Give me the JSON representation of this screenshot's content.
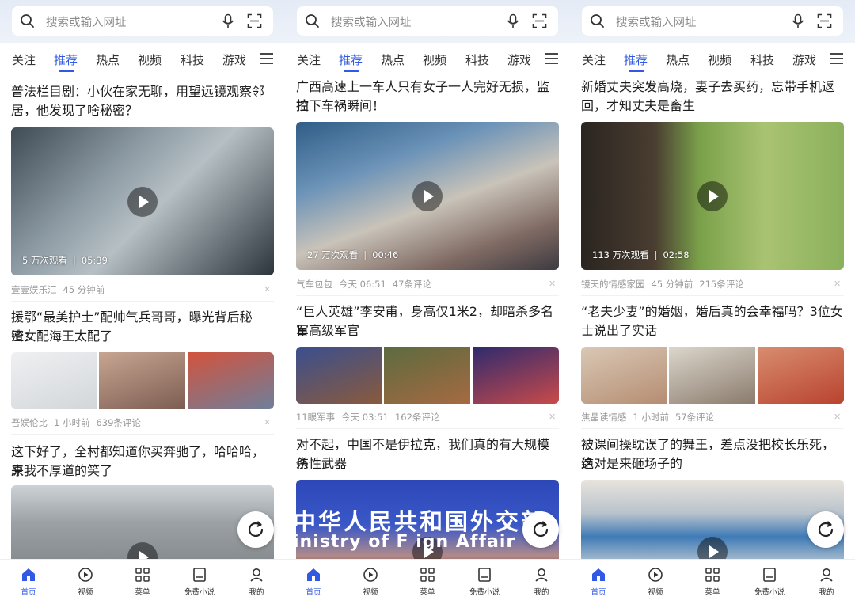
{
  "search": {
    "placeholder": "搜索或输入网址"
  },
  "tabs": [
    "关注",
    "推荐",
    "热点",
    "视频",
    "科技",
    "游戏"
  ],
  "active_tab": "推荐",
  "bottom_nav": [
    "首页",
    "视频",
    "菜单",
    "免费小说",
    "我的"
  ],
  "active_nav": "首页",
  "panels": [
    {
      "cards": [
        {
          "kind": "video",
          "title_lines": [
            "普法栏目剧：小伙在家无聊，用望远镜观察邻",
            "居，他发现了啥秘密？"
          ],
          "views": "5 万次观看",
          "duration": "05:39",
          "meta": [
            "壹壹娱乐汇",
            "45 分钟前"
          ]
        },
        {
          "kind": "triple",
          "title_lines": [
            "援鄂“最美护士”配帅气兵哥哥，曝光背后秘密：",
            "渣女配海王太配了"
          ],
          "meta": [
            "吾娱伦比",
            "1 小时前",
            "639条评论"
          ]
        },
        {
          "kind": "video",
          "title_lines": [
            "这下好了，全村都知道你买奔驰了，哈哈哈，原",
            "来我不厚道的笑了"
          ]
        }
      ]
    },
    {
      "cards": [
        {
          "kind": "video",
          "title_lines": [
            "广西高速上一车人只有女子一人完好无损，监控",
            "拍下车祸瞬间！"
          ],
          "views": "27 万次观看",
          "duration": "00:46",
          "meta": [
            "气车包包",
            "今天 06:51",
            "47条评论"
          ]
        },
        {
          "kind": "triple",
          "title_lines": [
            "“巨人英雄”李安甫，身高仅1米2，却暗杀多名日",
            "军高级军官"
          ],
          "meta": [
            "11眼军事",
            "今天 03:51",
            "162条评论"
          ]
        },
        {
          "kind": "video",
          "title_lines": [
            "对不起，中国不是伊拉克，我们真的有大规模杀",
            "伤性武器"
          ],
          "image_text": [
            "中华人民共和国外交部",
            "inistry of F  ign Affair"
          ]
        }
      ]
    },
    {
      "cards": [
        {
          "kind": "video",
          "title_lines": [
            "新婚丈夫突发高烧，妻子去买药，忘带手机返",
            "回，才知丈夫是畜生"
          ],
          "views": "113 万次观看",
          "duration": "02:58",
          "meta": [
            "镜天的情感家园",
            "45 分钟前",
            "215条评论"
          ]
        },
        {
          "kind": "triple",
          "title_lines": [
            "“老夫少妻”的婚姻，婚后真的会幸福吗？3位女",
            "士说出了实话"
          ],
          "meta": [
            "焦晶读情感",
            "1 小时前",
            "57条评论"
          ]
        },
        {
          "kind": "video",
          "title_lines": [
            "被课间操耽误了的舞王，差点没把校长乐死，这",
            "绝对是来砸场子的"
          ]
        }
      ]
    }
  ],
  "icons": {
    "search": "search-icon",
    "mic": "mic-icon",
    "scan": "scan-icon",
    "menu": "menu-icon",
    "close": "close-icon",
    "refresh": "refresh-icon",
    "play": "play-icon",
    "nav": [
      "home-icon",
      "video-icon",
      "grid-icon",
      "book-icon",
      "user-icon"
    ]
  },
  "colors": {
    "accent": "#3259e3",
    "topbar": "#e8eef8",
    "meta_text": "#9a9a9a"
  }
}
